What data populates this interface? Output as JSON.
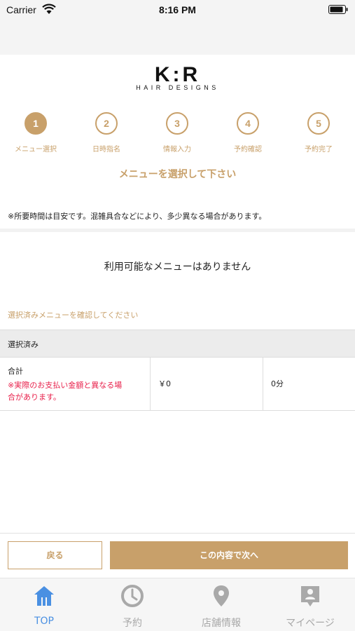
{
  "status_bar": {
    "carrier": "Carrier",
    "time": "8:16 PM"
  },
  "logo": {
    "main": "K:R",
    "sub": "HAIR DESIGNS"
  },
  "steps": [
    {
      "number": "1",
      "label": "メニュー選択",
      "active": true
    },
    {
      "number": "2",
      "label": "日時指名",
      "active": false
    },
    {
      "number": "3",
      "label": "情報入力",
      "active": false
    },
    {
      "number": "4",
      "label": "予約確認",
      "active": false
    },
    {
      "number": "5",
      "label": "予約完了",
      "active": false
    }
  ],
  "page_heading": "メニューを選択して下さい",
  "notice": "※所要時間は目安です。混雑具合などにより、多少異なる場合があります。",
  "empty_message": "利用可能なメニューはありません",
  "confirm_text": "選択済みメニューを確認してください",
  "selected": {
    "header": "選択済み",
    "total_label": "合計",
    "warning_line1": "※実際のお支払い金額と異なる場",
    "warning_line2": "合があります。",
    "price": "￥0",
    "duration": "0分"
  },
  "buttons": {
    "back": "戻る",
    "next": "この内容で次へ"
  },
  "tabs": [
    {
      "label": "TOP",
      "icon": "home-icon",
      "active": true
    },
    {
      "label": "予約",
      "icon": "clock-icon",
      "active": false
    },
    {
      "label": "店舗情報",
      "icon": "location-pin-icon",
      "active": false
    },
    {
      "label": "マイページ",
      "icon": "profile-card-icon",
      "active": false
    }
  ],
  "colors": {
    "accent": "#c8a06a",
    "warning": "#e8204b",
    "tab_active": "#4a90e2",
    "tab_inactive": "#a9a9a9"
  }
}
